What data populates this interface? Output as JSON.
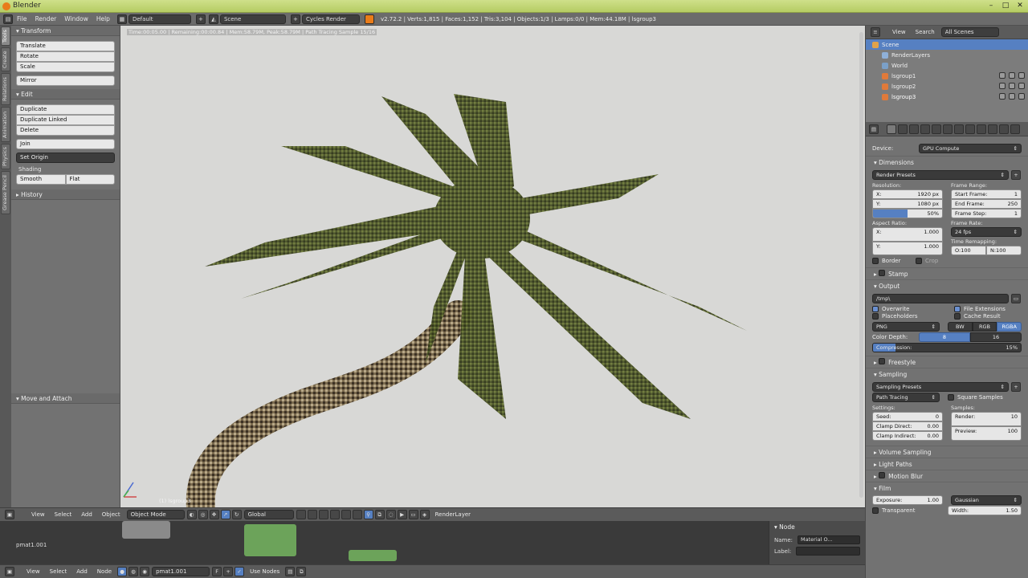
{
  "window": {
    "title": "Blender",
    "controls": [
      "–",
      "□",
      "✕"
    ]
  },
  "info_header": {
    "menus": [
      "File",
      "Render",
      "Window",
      "Help"
    ],
    "screen_layout": "Default",
    "scene": "Scene",
    "engine": "Cycles Render",
    "stats": "v2.72.2 | Verts:1,815 | Faces:1,152 | Tris:3,104 | Objects:1/3 | Lamps:0/0 | Mem:44.18M | lsgroup3"
  },
  "tool_tabs": [
    "Tools",
    "Create",
    "Relations",
    "Animation",
    "Physics",
    "Grease Pencil"
  ],
  "tool_shelf": {
    "transform": {
      "header": "Transform",
      "buttons": [
        "Translate",
        "Rotate",
        "Scale"
      ],
      "mirror": "Mirror"
    },
    "edit": {
      "header": "Edit",
      "buttons": [
        "Duplicate",
        "Duplicate Linked",
        "Delete"
      ],
      "join": "Join",
      "set_origin": "Set Origin",
      "shading_label": "Shading",
      "smooth": "Smooth",
      "flat": "Flat"
    },
    "history": "History",
    "move_attach": "Move and Attach"
  },
  "viewport": {
    "status": "Time:00:05.00 | Remaining:00:00.84 | Mem:58.79M, Peak:58.79M | Path Tracing Sample 15/16",
    "object_label": "(1) lsgroup3",
    "axis": {
      "x_color": "#d14a4a",
      "y_color": "#4ab24a",
      "z_color": "#4a6ad1"
    }
  },
  "viewport_header": {
    "menus": [
      "View",
      "Select",
      "Add",
      "Object"
    ],
    "mode": "Object Mode",
    "pivot": "Global",
    "render_layer": "RenderLayer"
  },
  "node_editor": {
    "material_label": "pmat1.001",
    "sidebar_title": "Node",
    "name_label": "Name:",
    "name_value": "Material O...",
    "label_label": "Label:"
  },
  "node_header": {
    "menus": [
      "View",
      "Select",
      "Add",
      "Node"
    ],
    "material": "pmat1.001",
    "use_nodes": "Use Nodes"
  },
  "outliner": {
    "header_menus": [
      "View",
      "Search"
    ],
    "filter": "All Scenes",
    "items": [
      {
        "label": "Scene",
        "selected": true,
        "color": "#e0a24a"
      },
      {
        "label": "RenderLayers",
        "selected": false,
        "color": "#8fb0d8"
      },
      {
        "label": "World",
        "selected": false,
        "color": "#7ba0c8"
      },
      {
        "label": "lsgroup1",
        "selected": false,
        "color": "#e07a3a"
      },
      {
        "label": "lsgroup2",
        "selected": false,
        "color": "#e07a3a"
      },
      {
        "label": "lsgroup3",
        "selected": false,
        "color": "#e07a3a"
      }
    ]
  },
  "properties": {
    "device_label": "Device:",
    "device_value": "GPU Compute",
    "dimensions_header": "Dimensions",
    "render_presets": "Render Presets",
    "resolution_label": "Resolution:",
    "res_x": {
      "label": "X:",
      "value": "1920 px"
    },
    "res_y": {
      "label": "Y:",
      "value": "1080 px"
    },
    "res_pct": {
      "value": "50%",
      "fraction": 0.5
    },
    "frame_range_label": "Frame Range:",
    "start_frame": {
      "label": "Start Frame:",
      "value": "1"
    },
    "end_frame": {
      "label": "End Frame:",
      "value": "250"
    },
    "frame_step": {
      "label": "Frame Step:",
      "value": "1"
    },
    "aspect_label": "Aspect Ratio:",
    "aspect_x": {
      "label": "X:",
      "value": "1.000"
    },
    "aspect_y": {
      "label": "Y:",
      "value": "1.000"
    },
    "frame_rate_label": "Frame Rate:",
    "frame_rate": "24 fps",
    "time_remap_label": "Time Remapping:",
    "time_old": "O:100",
    "time_new": "N:100",
    "border": "Border",
    "crop": "Crop",
    "stamp": "Stamp",
    "output_header": "Output",
    "output_path": "/tmp\\",
    "overwrite": "Overwrite",
    "file_extensions": "File Extensions",
    "placeholders": "Placeholders",
    "cache_result": "Cache Result",
    "format": "PNG",
    "color_modes": [
      "BW",
      "RGB",
      "RGBA"
    ],
    "color_depth_label": "Color Depth:",
    "color_depths": [
      "8",
      "16"
    ],
    "compression_label": "Compression:",
    "compression_value": "15%",
    "compression_fraction": 0.15,
    "freestyle": "Freestyle",
    "sampling_header": "Sampling",
    "sampling_presets": "Sampling Presets",
    "integrator": "Path Tracing",
    "square_samples": "Square Samples",
    "settings_label": "Settings:",
    "samples_label": "Samples:",
    "seed": {
      "label": "Seed:",
      "value": "0"
    },
    "clamp_direct": {
      "label": "Clamp Direct:",
      "value": "0.00"
    },
    "clamp_indirect": {
      "label": "Clamp Indirect:",
      "value": "0.00"
    },
    "render_samples": {
      "label": "Render:",
      "value": "10"
    },
    "preview_samples": {
      "label": "Preview:",
      "value": "100"
    },
    "volume_sampling": "Volume Sampling",
    "light_paths": "Light Paths",
    "motion_blur": "Motion Blur",
    "film_header": "Film",
    "exposure": {
      "label": "Exposure:",
      "value": "1.00"
    },
    "filter_type": "Gaussian",
    "transparent": "Transparent",
    "width": {
      "label": "Width:",
      "value": "1.50"
    }
  }
}
